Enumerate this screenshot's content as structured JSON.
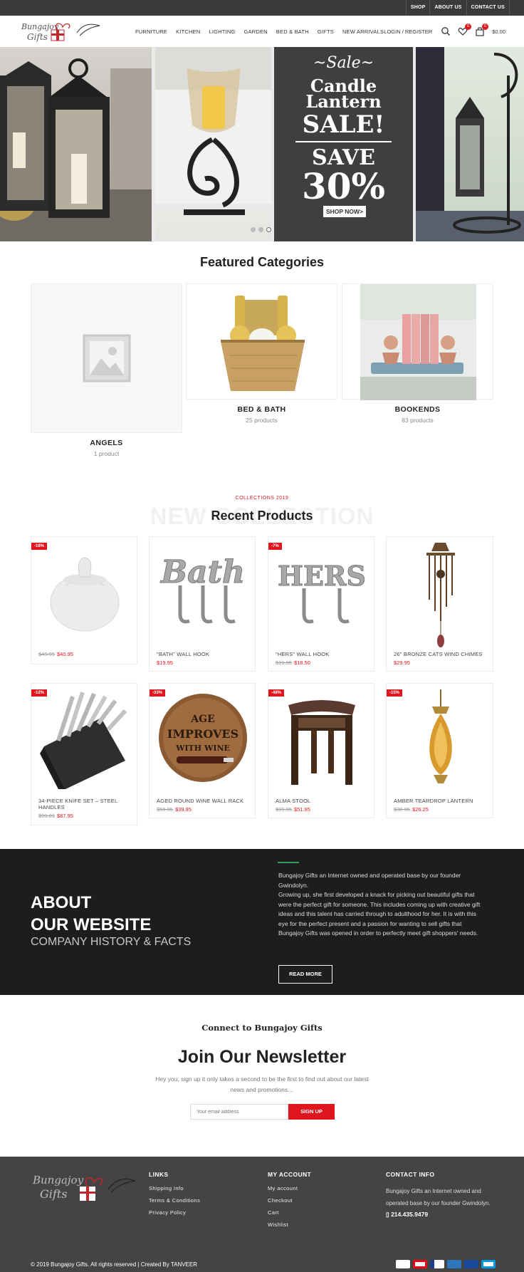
{
  "topbar": {
    "links": [
      "SHOP",
      "ABOUT US",
      "CONTACT US"
    ]
  },
  "header": {
    "brand_line1": "Bungajoy",
    "brand_line2": "Gifts",
    "nav": [
      "FURNITURE",
      "KITCHEN",
      "LIGHTING",
      "GARDEN",
      "BED & BATH",
      "GIFTS",
      "NEW ARRIVALS"
    ],
    "login": "LOGIN / REGISTER",
    "wishlist_count": "0",
    "cart_count": "0",
    "cart_total": "$0.00"
  },
  "hero": {
    "sale_word": "~Sale~",
    "title_line1": "Candle",
    "title_line2": "Lantern",
    "title_line3": "SALE!",
    "save": "SAVE",
    "percent": "30%",
    "cta": "SHOP NOW>"
  },
  "featured": {
    "title": "Featured Categories",
    "items": [
      {
        "name": "ANGELS",
        "count": "1 product"
      },
      {
        "name": "BED & BATH",
        "count": "25 products"
      },
      {
        "name": "BOOKENDS",
        "count": "83 products"
      }
    ]
  },
  "recent": {
    "kicker": "COLLECTIONS 2019",
    "watermark": "NEW COLLECTION",
    "title": "Recent Products",
    "products": [
      {
        "badge": "-18%",
        "name": "",
        "old": "$49.95",
        "price": "$40.95"
      },
      {
        "badge": "",
        "name": "\"BATH\" WALL HOOK",
        "old": "",
        "price": "$19.95"
      },
      {
        "badge": "-7%",
        "name": "\"HERS\" WALL HOOK",
        "old": "$19.95",
        "price": "$18.50"
      },
      {
        "badge": "",
        "name": "26\" BRONZE CATS WIND CHIMES",
        "old": "",
        "price": "$29.95"
      },
      {
        "badge": "-12%",
        "name": "34-PIECE KNIFE SET – STEEL HANDLES",
        "old": "$99.99",
        "price": "$87.95"
      },
      {
        "badge": "-33%",
        "name": "AGED ROUND WINE WALL RACK",
        "old": "$59.95",
        "price": "$39.95"
      },
      {
        "badge": "-48%",
        "name": "ALMA STOOL",
        "old": "$99.95",
        "price": "$51.95"
      },
      {
        "badge": "-15%",
        "name": "AMBER TEARDROP LANTERN",
        "old": "$30.95",
        "price": "$26.25"
      }
    ],
    "plaque_lines": [
      "AGE",
      "IMPROVES",
      "WITH WINE"
    ],
    "bath_word": "Bath",
    "hers_word": "HERS"
  },
  "about": {
    "heading_line1": "ABOUT",
    "heading_line2": "OUR WEBSITE",
    "subheading": "COMPANY HISTORY & FACTS",
    "paragraph1": "Bungajoy Gifts an Internet owned and operated base by our founder Gwindolyn.",
    "paragraph2": "Growing up, she first developed a knack for picking out beautiful gifts that were the perfect gift for someone. This includes coming up with creative gift ideas and this talent has carried through to adulthood for her. It is with this eye for the perfect present and a passion for wanting to sell gifts that Bungajoy Gifts was opened in order to perfectly meet gift shoppers' needs.",
    "button": "READ MORE"
  },
  "newsletter": {
    "connect": "Connect to Bungajoy Gifts",
    "title": "Join Our Newsletter",
    "text": "Hey you, sign up it only takes a second to be the first to find out about our latest news and promotions…",
    "placeholder": "Your email address",
    "button": "SIGN UP"
  },
  "footer": {
    "links_title": "LINKS",
    "links": [
      "Shipping Info",
      "Terms & Conditions",
      "Privacy Policy"
    ],
    "account_title": "MY ACCOUNT",
    "account": [
      "My account",
      "Checkout",
      "Cart",
      "Wishlist"
    ],
    "contact_title": "CONTACT INFO",
    "contact_text": "Bungajoy Gifts an Internet owned and operated base by our founder Gwindolyn.",
    "phone": "214.435.9479",
    "copyright": "© 2019 Bungajoy Gifts. All rights reserved | Created By TANVEER",
    "cards": [
      "visa",
      "mastercard",
      "paypal",
      "amex",
      "visa-electron",
      "maestro"
    ]
  },
  "colors": {
    "accent": "#e0161e",
    "dark": "#1d1d1d",
    "footer": "#444444",
    "topbar": "#3a3a3a"
  }
}
